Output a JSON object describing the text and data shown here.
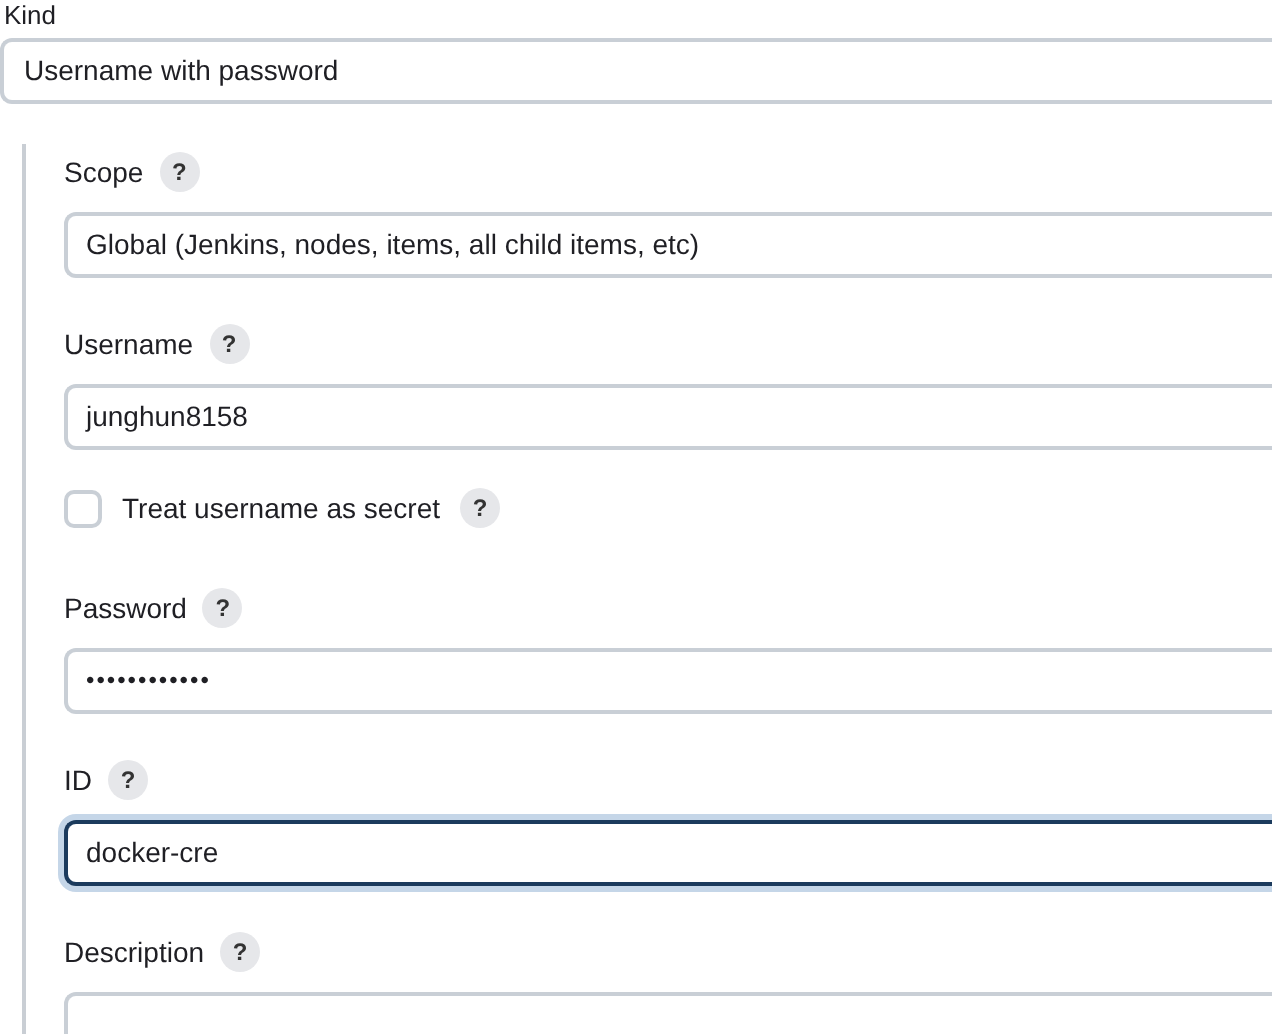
{
  "kind": {
    "label": "Kind",
    "value": "Username with password"
  },
  "fields": [
    {
      "kind": "select",
      "label": "Scope",
      "help": "?",
      "value": "Global (Jenkins, nodes, items, all child items, etc)",
      "focused": false
    },
    {
      "kind": "text",
      "label": "Username",
      "help": "?",
      "value": "junghun8158",
      "focused": false
    },
    {
      "kind": "checkbox",
      "label": "Treat username as secret",
      "help": "?",
      "checked": false
    },
    {
      "kind": "password",
      "label": "Password",
      "help": "?",
      "value": "••••••••••••",
      "focused": false
    },
    {
      "kind": "text",
      "label": "ID",
      "help": "?",
      "value": "docker-cre",
      "focused": true
    },
    {
      "kind": "textarea",
      "label": "Description",
      "help": "?",
      "focused": false
    }
  ]
}
